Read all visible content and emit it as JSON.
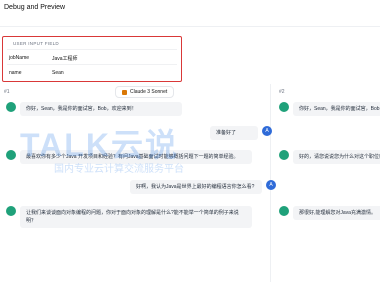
{
  "header": {
    "title": "Debug and Preview"
  },
  "input_panel": {
    "heading": "USER INPUT FIELD",
    "rows": [
      {
        "key": "jobName",
        "value": "Java工程师"
      },
      {
        "key": "name",
        "value": "Sean"
      }
    ]
  },
  "columns": {
    "col1": {
      "index": "#1",
      "model": "Claude 3 Sonnet"
    },
    "col2": {
      "index": "#2"
    }
  },
  "conversation": {
    "col1": [
      {
        "role": "bot",
        "text": "你好，Sean，我是你的面试官，Bob，欢迎来到！"
      },
      {
        "role": "user",
        "avatar": "A",
        "text": "准备好了"
      },
      {
        "role": "bot",
        "text": "最喜欢你有多少个Java 开发项目和经验？有问Java基础面试时能够概括问题下一题的简单经验。"
      },
      {
        "role": "user",
        "avatar": "A",
        "text": "好啊，我认为Java是世界上最好的编程语言你怎么看?"
      },
      {
        "role": "bot",
        "text": "让我们来谈谈面向对象编程的问题，你对于面向对象的理解是什么?能不能举一个简单的例子来说明？"
      }
    ],
    "col2": [
      {
        "role": "bot",
        "text": "你好，Sean，我是你的面试官，Bob，欢迎…"
      },
      {
        "role": "bot",
        "text": "好的，请您说说您为什么对这个职位感兴…"
      },
      {
        "role": "bot",
        "text": "那很好,能理解您对Java充满激情。"
      }
    ]
  },
  "watermark": {
    "main": "TALK云说",
    "sub": "国内专业云计算交流服务平台"
  }
}
